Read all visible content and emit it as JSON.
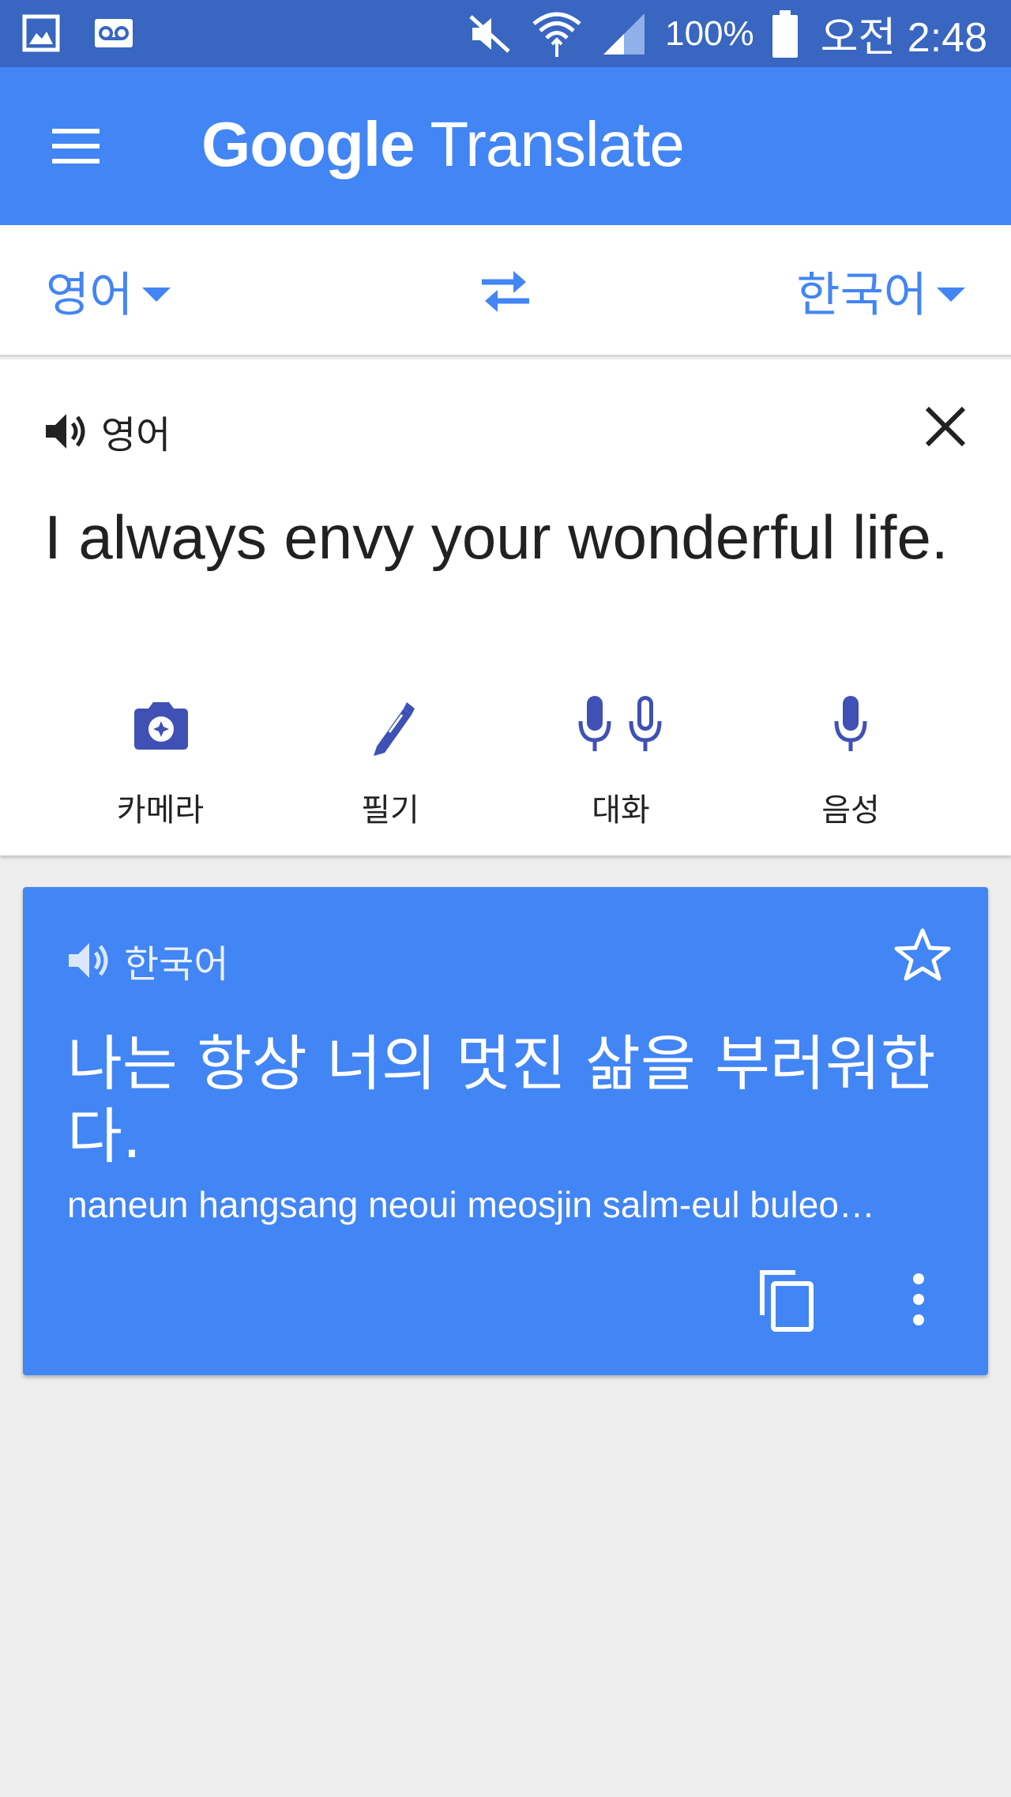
{
  "status_bar": {
    "battery": "100%",
    "time": "오전 2:48",
    "icons": [
      "gallery-icon",
      "voicemail-icon",
      "mute-icon",
      "wifi-icon",
      "signal-icon",
      "battery-icon"
    ]
  },
  "app_bar": {
    "title_google": "Google",
    "title_rest": " Translate",
    "menu_icon": "menu-icon"
  },
  "language_bar": {
    "source_language": "영어",
    "target_language": "한국어",
    "swap_icon": "swap-icon"
  },
  "input": {
    "language_label": "영어",
    "text": "I always envy your wonderful life.",
    "tools": [
      {
        "label": "카메라",
        "icon": "camera-icon"
      },
      {
        "label": "필기",
        "icon": "handwriting-icon"
      },
      {
        "label": "대화",
        "icon": "conversation-icon"
      },
      {
        "label": "음성",
        "icon": "voice-icon"
      }
    ]
  },
  "result": {
    "language_label": "한국어",
    "text": "나는 항상 너의 멋진 삶을 부러워한다.",
    "romanization": "naneun hangsang neoui meosjin salm-eul buleo…"
  },
  "colors": {
    "status_bar": "#3866c0",
    "accent": "#4285f4",
    "icon_blue": "#3f51b5",
    "background": "#ededed"
  }
}
